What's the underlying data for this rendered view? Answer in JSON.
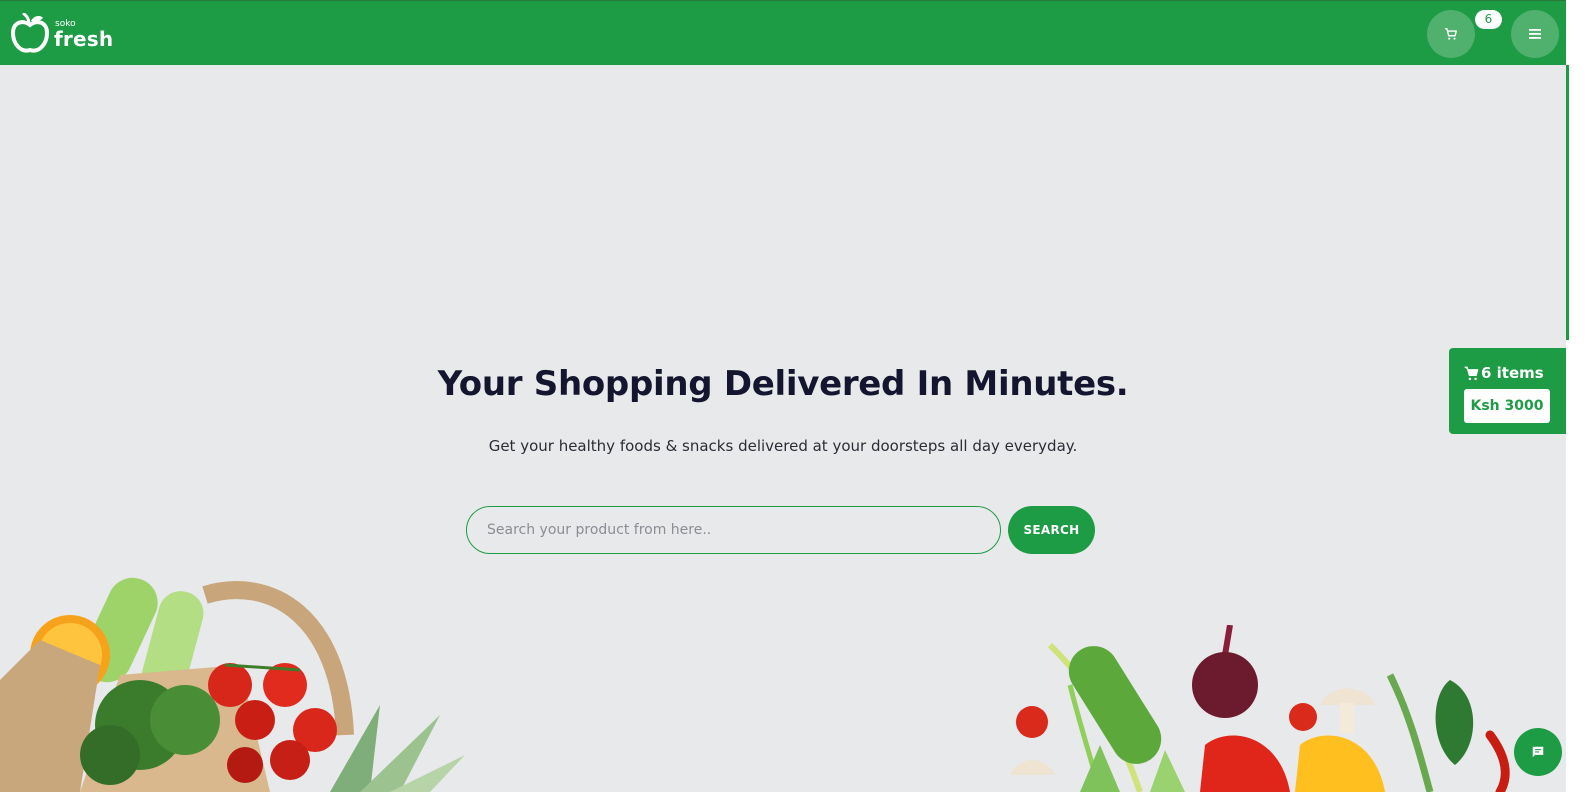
{
  "header": {
    "brand_small": "soko",
    "brand_big": "fresh",
    "cart_count": "6"
  },
  "hero": {
    "title": "Your Shopping Delivered In Minutes.",
    "subtitle": "Get your healthy foods & snacks delivered at your doorsteps all day everyday."
  },
  "search": {
    "placeholder": "Search your product from here..",
    "value": "",
    "button_label": "SEARCH"
  },
  "floating_cart": {
    "items_label": "6 items",
    "price": "Ksh 3000"
  },
  "icons": {
    "logo": "apple-logo-icon",
    "cart": "cart-icon",
    "menu": "menu-icon",
    "chat": "chat-icon"
  },
  "colors": {
    "brand_green": "#1e9b45",
    "background": "#e8e9eb",
    "title_text": "#14152e"
  }
}
